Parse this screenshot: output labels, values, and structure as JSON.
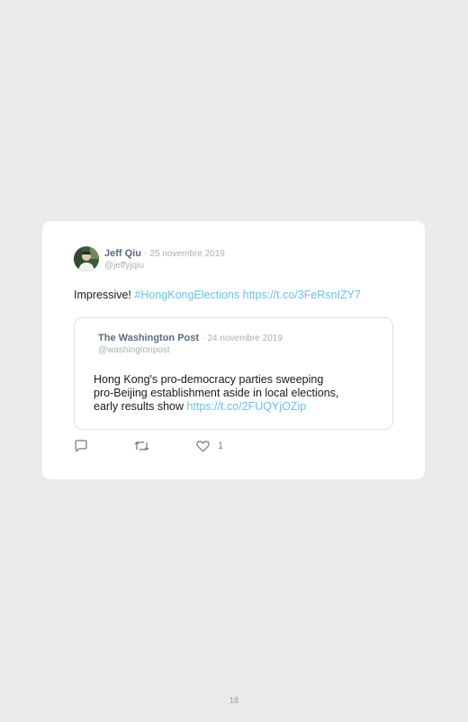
{
  "tweet": {
    "author_name": "Jeff Qiu",
    "separator": "·",
    "date": "25 novembre 2019",
    "handle": "@jeffyjqiu",
    "text_prefix": "Impressive!",
    "hashtag": "#HongKongElections",
    "link": "https://t.co/3FeRsnIZY7"
  },
  "quote": {
    "author_name": "The Washington Post",
    "separator": "·",
    "date": "24 novembre 2019",
    "handle": "@washingtonpost",
    "line1": "Hong Kong's pro-democracy parties sweeping",
    "line2": "pro-Beijing establishment aside in local elections,",
    "line3_prefix": "early results show",
    "link": "https://t.co/2FUQYjOZip"
  },
  "actions": {
    "reply_icon": "comment-bubble-icon",
    "retweet_icon": "retweet-icon",
    "like_icon": "heart-icon",
    "like_count": "1"
  },
  "footer": {
    "page_number": "18"
  },
  "colors": {
    "background": "#ebebeb",
    "card": "#ffffff",
    "link": "#6cc0e8",
    "author": "#5b6b7b",
    "muted": "#a8b0b7"
  }
}
